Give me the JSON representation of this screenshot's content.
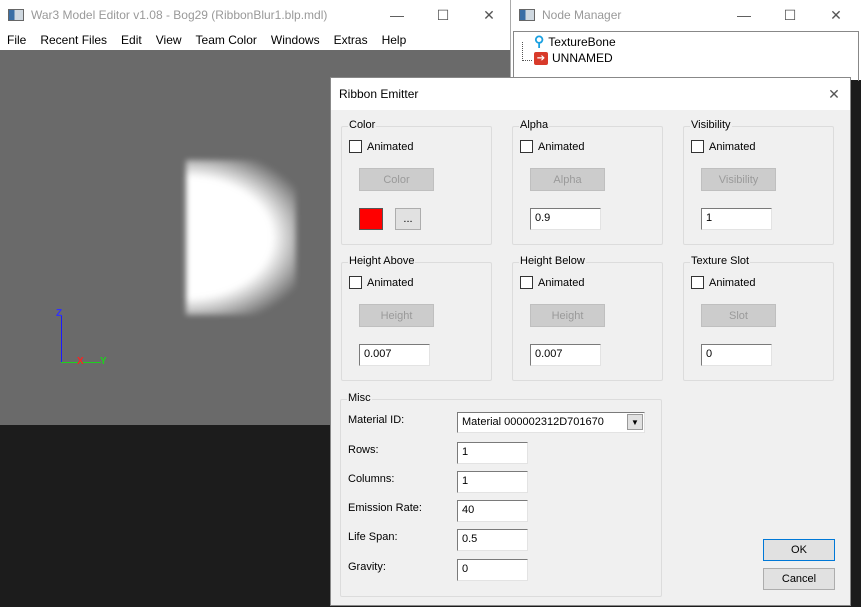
{
  "main_window": {
    "title": "War3 Model Editor v1.08 - Bog29 (RibbonBlur1.blp.mdl)",
    "menu": [
      "File",
      "Recent Files",
      "Edit",
      "View",
      "Team Color",
      "Windows",
      "Extras",
      "Help"
    ],
    "axes": {
      "z": "Z",
      "x": "X",
      "y": "Y"
    }
  },
  "node_manager": {
    "title": "Node Manager",
    "nodes": [
      {
        "label": "TextureBone",
        "icon": "bone-icon"
      },
      {
        "label": "UNNAMED",
        "icon": "ribbon-emitter-icon"
      }
    ]
  },
  "dialog": {
    "title": "Ribbon Emitter",
    "groups": {
      "color": {
        "legend": "Color",
        "animated": "Animated",
        "button": "Color",
        "swatch": "#ff0000",
        "more": "..."
      },
      "alpha": {
        "legend": "Alpha",
        "animated": "Animated",
        "button": "Alpha",
        "value": "0.9"
      },
      "visibility": {
        "legend": "Visibility",
        "animated": "Animated",
        "button": "Visibility",
        "value": "1"
      },
      "height_above": {
        "legend": "Height Above",
        "animated": "Animated",
        "button": "Height",
        "value": "0.007"
      },
      "height_below": {
        "legend": "Height Below",
        "animated": "Animated",
        "button": "Height",
        "value": "0.007"
      },
      "texture_slot": {
        "legend": "Texture Slot",
        "animated": "Animated",
        "button": "Slot",
        "value": "0"
      }
    },
    "misc": {
      "legend": "Misc",
      "material_label": "Material ID:",
      "material_value": "Material 000002312D701670",
      "rows_label": "Rows:",
      "rows": "1",
      "columns_label": "Columns:",
      "columns": "1",
      "emission_label": "Emission Rate:",
      "emission": "40",
      "lifespan_label": "Life Span:",
      "lifespan": "0.5",
      "gravity_label": "Gravity:",
      "gravity": "0"
    },
    "ok": "OK",
    "cancel": "Cancel"
  }
}
